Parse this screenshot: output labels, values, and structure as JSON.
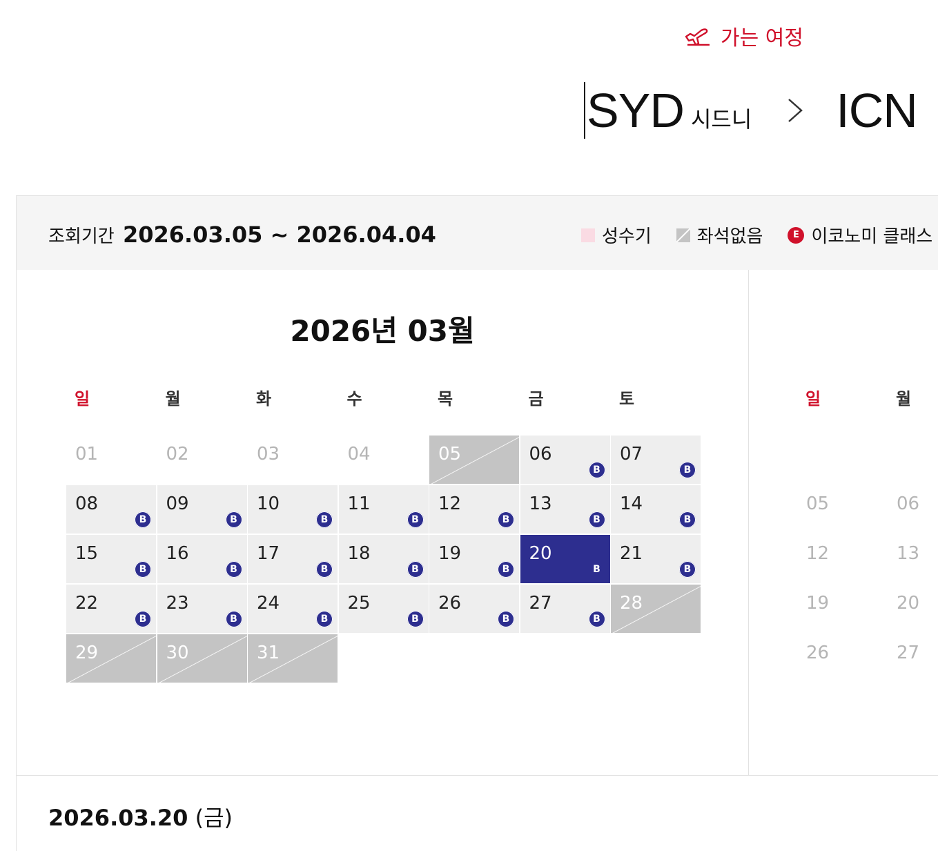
{
  "journey": {
    "label": "가는 여정",
    "icon": "plane-icon",
    "color": "#d0112b"
  },
  "route": {
    "from_code": "SYD",
    "from_city": "시드니",
    "to_code": "ICN"
  },
  "period": {
    "label": "조회기간",
    "value": "2026.03.05 ~ 2026.04.04"
  },
  "legend": {
    "peak": "성수기",
    "no_seat": "좌석없음",
    "economy_badge": "E",
    "economy": "이코노미 클래스"
  },
  "calendar": {
    "month_title": "2026년 03월",
    "weekdays": [
      "일",
      "월",
      "화",
      "수",
      "목",
      "금",
      "토"
    ],
    "days": [
      {
        "d": "01",
        "s": "inactive"
      },
      {
        "d": "02",
        "s": "inactive"
      },
      {
        "d": "03",
        "s": "inactive"
      },
      {
        "d": "04",
        "s": "inactive"
      },
      {
        "d": "05",
        "s": "noseat"
      },
      {
        "d": "06",
        "s": "avail"
      },
      {
        "d": "07",
        "s": "avail"
      },
      {
        "d": "08",
        "s": "avail"
      },
      {
        "d": "09",
        "s": "avail"
      },
      {
        "d": "10",
        "s": "avail"
      },
      {
        "d": "11",
        "s": "avail"
      },
      {
        "d": "12",
        "s": "avail"
      },
      {
        "d": "13",
        "s": "avail"
      },
      {
        "d": "14",
        "s": "avail"
      },
      {
        "d": "15",
        "s": "avail"
      },
      {
        "d": "16",
        "s": "avail"
      },
      {
        "d": "17",
        "s": "avail"
      },
      {
        "d": "18",
        "s": "avail"
      },
      {
        "d": "19",
        "s": "avail"
      },
      {
        "d": "20",
        "s": "selected"
      },
      {
        "d": "21",
        "s": "avail"
      },
      {
        "d": "22",
        "s": "avail"
      },
      {
        "d": "23",
        "s": "avail"
      },
      {
        "d": "24",
        "s": "avail"
      },
      {
        "d": "25",
        "s": "avail"
      },
      {
        "d": "26",
        "s": "avail"
      },
      {
        "d": "27",
        "s": "avail"
      },
      {
        "d": "28",
        "s": "noseat"
      },
      {
        "d": "29",
        "s": "noseat"
      },
      {
        "d": "30",
        "s": "noseat"
      },
      {
        "d": "31",
        "s": "noseat"
      }
    ],
    "badge": "B"
  },
  "next_calendar": {
    "weekdays": [
      "일",
      "월"
    ],
    "rows": [
      [
        "05",
        "06"
      ],
      [
        "12",
        "13"
      ],
      [
        "19",
        "20"
      ],
      [
        "26",
        "27"
      ]
    ]
  },
  "selected": {
    "date": "2026.03.20",
    "weekday": "(금)"
  }
}
